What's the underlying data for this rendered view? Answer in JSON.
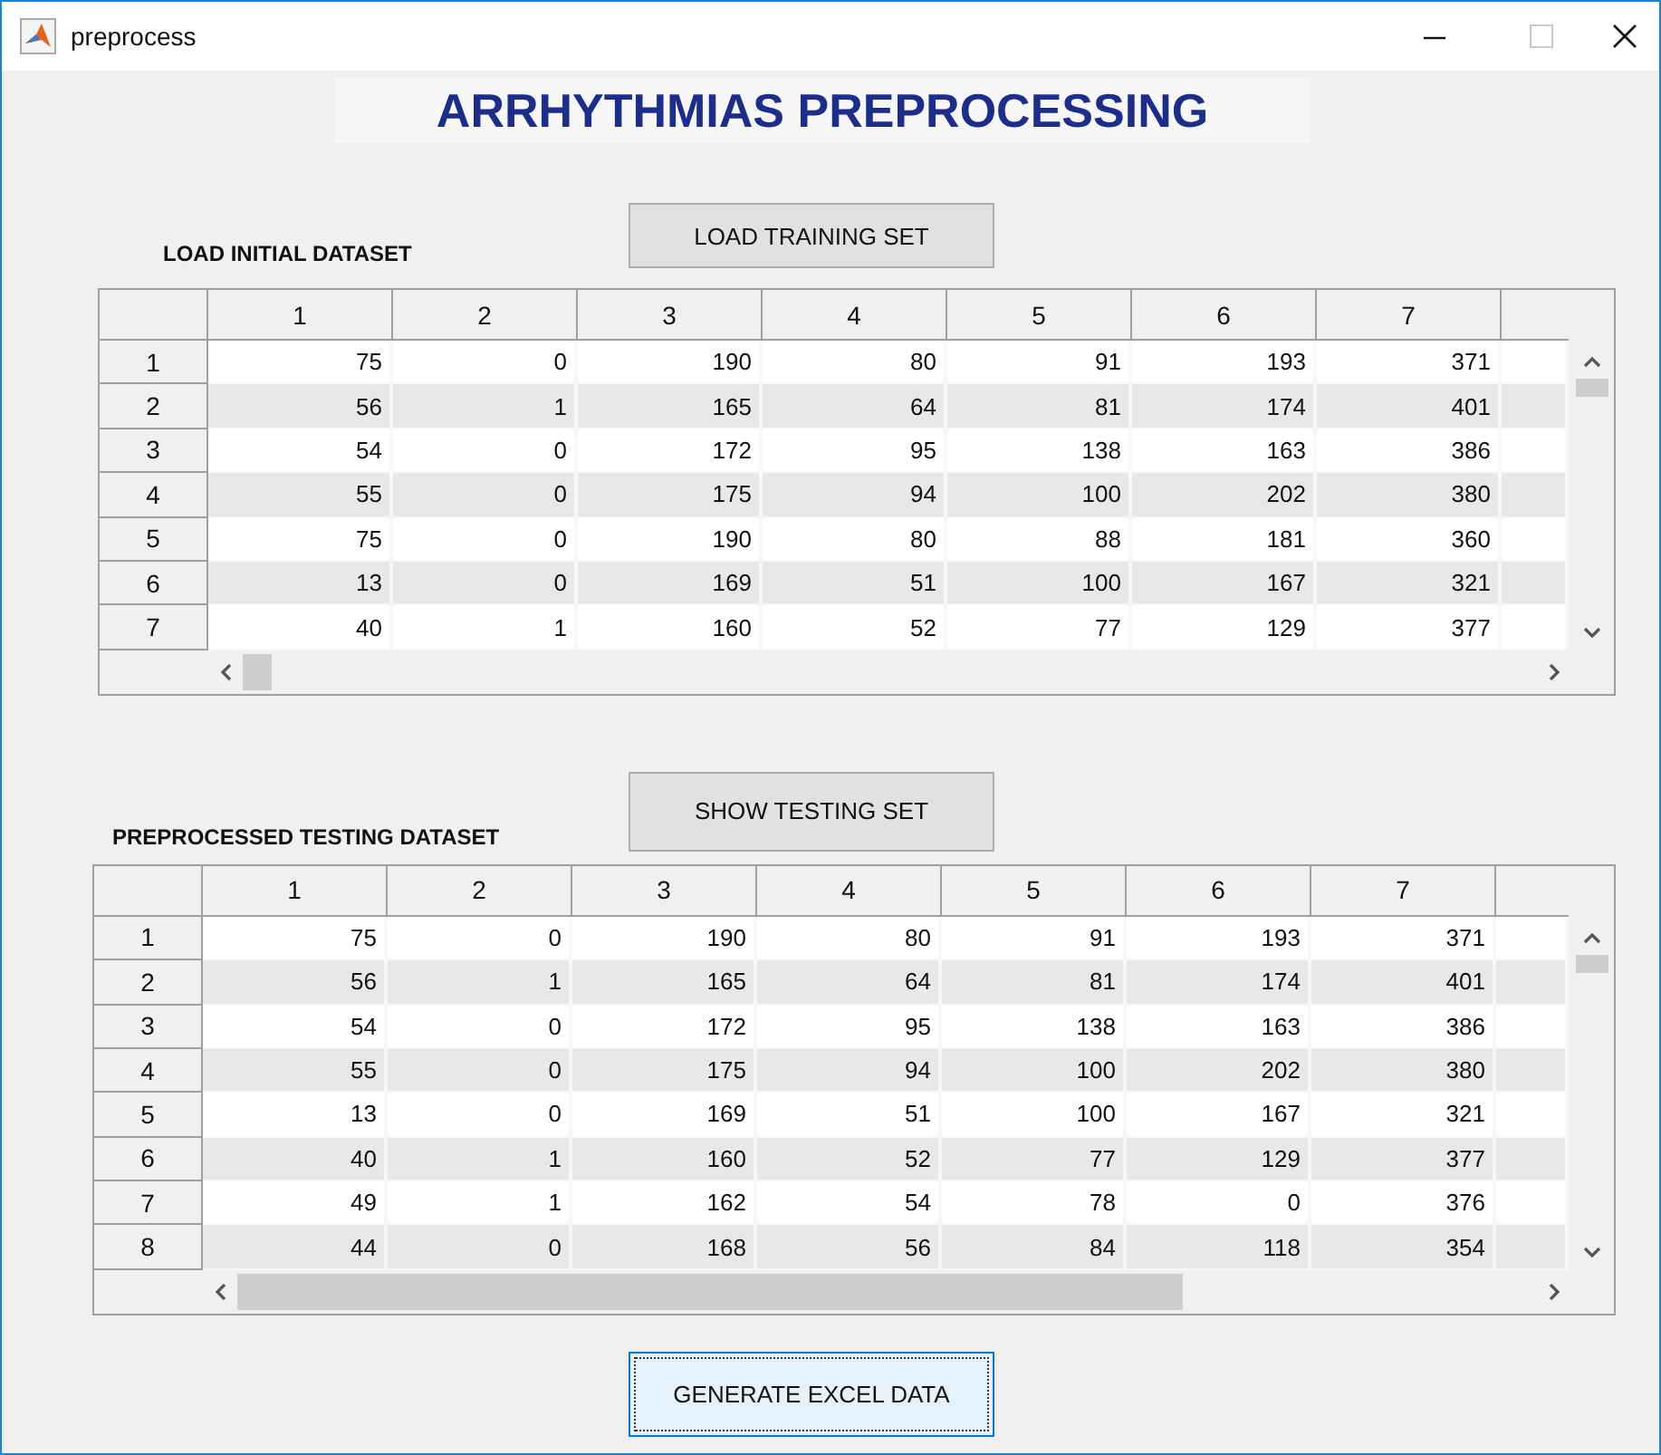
{
  "window": {
    "title": "preprocess"
  },
  "heading": "ARRHYTHMIAS PREPROCESSING",
  "sections": [
    {
      "label": "LOAD INITIAL DATASET",
      "button": {
        "label": "LOAD TRAINING SET",
        "focused": false
      },
      "table": {
        "columns": [
          "1",
          "2",
          "3",
          "4",
          "5",
          "6",
          "7"
        ],
        "rows": [
          {
            "header": "1",
            "cells": [
              "75",
              "0",
              "190",
              "80",
              "91",
              "193",
              "371"
            ]
          },
          {
            "header": "2",
            "cells": [
              "56",
              "1",
              "165",
              "64",
              "81",
              "174",
              "401"
            ]
          },
          {
            "header": "3",
            "cells": [
              "54",
              "0",
              "172",
              "95",
              "138",
              "163",
              "386"
            ]
          },
          {
            "header": "4",
            "cells": [
              "55",
              "0",
              "175",
              "94",
              "100",
              "202",
              "380"
            ]
          },
          {
            "header": "5",
            "cells": [
              "75",
              "0",
              "190",
              "80",
              "88",
              "181",
              "360"
            ]
          },
          {
            "header": "6",
            "cells": [
              "13",
              "0",
              "169",
              "51",
              "100",
              "167",
              "321"
            ]
          },
          {
            "header": "7",
            "cells": [
              "40",
              "1",
              "160",
              "52",
              "77",
              "129",
              "377"
            ]
          }
        ]
      }
    },
    {
      "label": "PREPROCESSED TESTING DATASET",
      "button": {
        "label": "SHOW TESTING SET",
        "focused": false
      },
      "table": {
        "columns": [
          "1",
          "2",
          "3",
          "4",
          "5",
          "6",
          "7"
        ],
        "rows": [
          {
            "header": "1",
            "cells": [
              "75",
              "0",
              "190",
              "80",
              "91",
              "193",
              "371"
            ]
          },
          {
            "header": "2",
            "cells": [
              "56",
              "1",
              "165",
              "64",
              "81",
              "174",
              "401"
            ]
          },
          {
            "header": "3",
            "cells": [
              "54",
              "0",
              "172",
              "95",
              "138",
              "163",
              "386"
            ]
          },
          {
            "header": "4",
            "cells": [
              "55",
              "0",
              "175",
              "94",
              "100",
              "202",
              "380"
            ]
          },
          {
            "header": "5",
            "cells": [
              "13",
              "0",
              "169",
              "51",
              "100",
              "167",
              "321"
            ]
          },
          {
            "header": "6",
            "cells": [
              "40",
              "1",
              "160",
              "52",
              "77",
              "129",
              "377"
            ]
          },
          {
            "header": "7",
            "cells": [
              "49",
              "1",
              "162",
              "54",
              "78",
              "0",
              "376"
            ]
          },
          {
            "header": "8",
            "cells": [
              "44",
              "0",
              "168",
              "56",
              "84",
              "118",
              "354"
            ]
          }
        ]
      }
    }
  ],
  "generate_button": {
    "label": "GENERATE EXCEL DATA",
    "focused": true
  }
}
